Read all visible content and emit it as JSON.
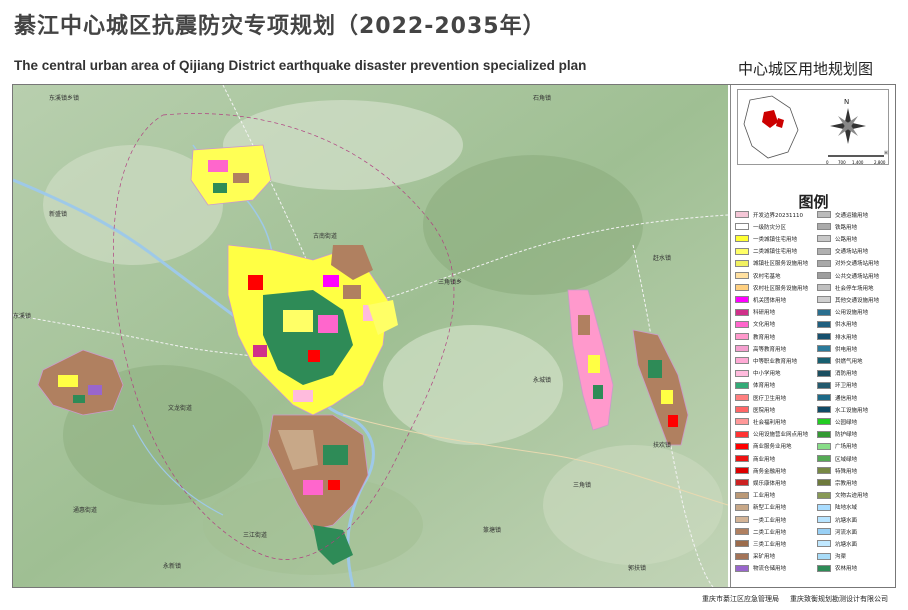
{
  "header": {
    "title": "綦江中心城区抗震防灾专项规划（2022-2035年）",
    "subtitle": "The central urban area  of Qijiang District earthquake disaster prevention  specialized plan",
    "map_title": "中心城区用地规划图"
  },
  "legend": {
    "title": "图例",
    "col1": [
      {
        "label": "开发边界20231110",
        "color": "#f4c6d6"
      },
      {
        "label": "一级防灾分区",
        "color": "#ffffff"
      },
      {
        "label": "一类城镇住宅用地",
        "color": "#ffff33"
      },
      {
        "label": "二类城镇住宅用地",
        "color": "#ffff66"
      },
      {
        "label": "城镇社区服务设施用地",
        "color": "#f0f060"
      },
      {
        "label": "农村宅基地",
        "color": "#ffe0a0"
      },
      {
        "label": "农村社区服务设施用地",
        "color": "#ffd080"
      },
      {
        "label": "机关团体用地",
        "color": "#ff00ff"
      },
      {
        "label": "科研用地",
        "color": "#d0308a"
      },
      {
        "label": "文化用地",
        "color": "#ff66cc"
      },
      {
        "label": "教育用地",
        "color": "#ff99cc"
      },
      {
        "label": "高等教育用地",
        "color": "#f5a0d0"
      },
      {
        "label": "中等职业教育用地",
        "color": "#ffaad5"
      },
      {
        "label": "中小学用地",
        "color": "#ffbbdd"
      },
      {
        "label": "体育用地",
        "color": "#33aa77"
      },
      {
        "label": "医疗卫生用地",
        "color": "#ff7f7f"
      },
      {
        "label": "医院用地",
        "color": "#ff6666"
      },
      {
        "label": "社会福利用地",
        "color": "#ff9999"
      },
      {
        "label": "公用设施营业网点用地",
        "color": "#ff3333"
      },
      {
        "label": "商业服务业用地",
        "color": "#ff0000"
      },
      {
        "label": "商业用地",
        "color": "#ee1111"
      },
      {
        "label": "商务金融用地",
        "color": "#dd0000"
      },
      {
        "label": "娱乐康体用地",
        "color": "#cc2222"
      },
      {
        "label": "工业用地",
        "color": "#bb9977"
      },
      {
        "label": "新型工业用地",
        "color": "#c8a888"
      },
      {
        "label": "一类工业用地",
        "color": "#d4b496"
      },
      {
        "label": "二类工业用地",
        "color": "#b08060"
      },
      {
        "label": "三类工业用地",
        "color": "#9c6c4c"
      },
      {
        "label": "采矿用地",
        "color": "#a47458"
      },
      {
        "label": "物流仓储用地",
        "color": "#9966cc"
      }
    ],
    "col2": [
      {
        "label": "交通运输用地",
        "color": "#bbbbbb"
      },
      {
        "label": "铁路用地",
        "color": "#aaaaaa"
      },
      {
        "label": "公路用地",
        "color": "#c8c8c8"
      },
      {
        "label": "交通场站用地",
        "color": "#b0b0b0"
      },
      {
        "label": "对外交通场站用地",
        "color": "#a8a8a8"
      },
      {
        "label": "公共交通场站用地",
        "color": "#9e9e9e"
      },
      {
        "label": "社会停车场用地",
        "color": "#c0c0c0"
      },
      {
        "label": "其他交通设施用地",
        "color": "#cfcfcf"
      },
      {
        "label": "公用设施用地",
        "color": "#2a6f8f"
      },
      {
        "label": "供水用地",
        "color": "#1f5f7f"
      },
      {
        "label": "排水用地",
        "color": "#16506e"
      },
      {
        "label": "供电用地",
        "color": "#2b7a9a"
      },
      {
        "label": "供燃气用地",
        "color": "#175f70"
      },
      {
        "label": "消防用地",
        "color": "#1a4e60"
      },
      {
        "label": "环卫用地",
        "color": "#235a6e"
      },
      {
        "label": "通信用地",
        "color": "#1d6a88"
      },
      {
        "label": "水工设施用地",
        "color": "#0f4a66"
      },
      {
        "label": "公园绿地",
        "color": "#22cc22"
      },
      {
        "label": "防护绿地",
        "color": "#339933"
      },
      {
        "label": "广场用地",
        "color": "#88dd88"
      },
      {
        "label": "区域绿地",
        "color": "#55aa55"
      },
      {
        "label": "特殊用地",
        "color": "#778844"
      },
      {
        "label": "宗教用地",
        "color": "#6e7a3c"
      },
      {
        "label": "文物古迹用地",
        "color": "#889955"
      },
      {
        "label": "陆地水域",
        "color": "#aaddff"
      },
      {
        "label": "坑塘水面",
        "color": "#b8e4ff"
      },
      {
        "label": "河流水面",
        "color": "#99d0f5"
      },
      {
        "label": "坑塘水面",
        "color": "#c0e8ff"
      },
      {
        "label": "沟渠",
        "color": "#a8dcf8"
      },
      {
        "label": "农林用地",
        "color": "#2e8b57"
      }
    ]
  },
  "inset": {
    "north_label": "N",
    "scale_labels": [
      "0",
      "700",
      "1,400",
      "2,800"
    ],
    "scale_unit": "米"
  },
  "map_labels": [
    "东溪镇乡镇",
    "三角镇乡",
    "永城镇",
    "石角镇",
    "新盛镇",
    "赶水镇",
    "东溪镇",
    "三江街道",
    "古南街道",
    "文龙街道",
    "通惠街道",
    "扶欢镇",
    "篆塘镇",
    "郭扶镇",
    "永新镇",
    "三角镇"
  ],
  "footer": {
    "org1": "重庆市綦江区应急管理局",
    "org2": "重庆致衡规划勘测设计有限公司"
  },
  "colors": {
    "terrain": "#a8c49a",
    "residential": "#ffff33",
    "industrial": "#b08060",
    "green": "#2e8b57",
    "river": "#9ec9e8"
  }
}
